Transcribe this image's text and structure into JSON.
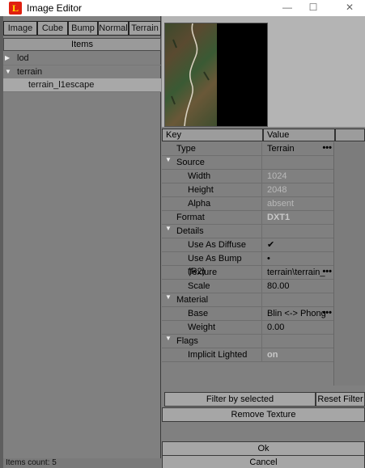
{
  "window": {
    "title": "Image Editor",
    "app_icon": "L",
    "minimize_glyph": "—",
    "maximize_glyph": "☐",
    "close_glyph": "✕"
  },
  "tabs": [
    "Image",
    "Cube",
    "Bump",
    "Normal",
    "Terrain"
  ],
  "items_header": "Items",
  "tree": [
    {
      "label": "lod",
      "arrow": "▶"
    },
    {
      "label": "terrain",
      "arrow": "▼"
    },
    {
      "label": "terrain_l1escape",
      "arrow": ""
    }
  ],
  "status": "Items count: 5",
  "grid": {
    "key_header": "Key",
    "value_header": "Value",
    "rows": [
      {
        "key": "Type",
        "value": "Terrain",
        "ellipsis": "•••"
      },
      {
        "key": "Source",
        "value": "",
        "group": true
      },
      {
        "key": "Width",
        "value": "1024"
      },
      {
        "key": "Height",
        "value": "2048"
      },
      {
        "key": "Alpha",
        "value": "absent"
      },
      {
        "key": "Format",
        "value": "DXT1"
      },
      {
        "key": "Details",
        "value": "",
        "group": true
      },
      {
        "key": "Use As Diffuse",
        "value": "✔"
      },
      {
        "key": "Use As Bump (R2)",
        "value": "•"
      },
      {
        "key": "Texture",
        "value": "terrain\\terrain_",
        "ellipsis": "•••"
      },
      {
        "key": "Scale",
        "value": "80.00"
      },
      {
        "key": "Material",
        "value": "",
        "group": true
      },
      {
        "key": "Base",
        "value": "Blin <-> Phong",
        "ellipsis": "•••"
      },
      {
        "key": "Weight",
        "value": "0.00"
      },
      {
        "key": "Flags",
        "value": "",
        "group": true
      },
      {
        "key": "Implicit Lighted",
        "value": "on"
      }
    ]
  },
  "buttons": {
    "filter": "Filter by selected",
    "reset": "Reset Filter",
    "remove": "Remove Texture",
    "ok": "Ok",
    "cancel": "Cancel"
  },
  "group_arrow": "▼"
}
